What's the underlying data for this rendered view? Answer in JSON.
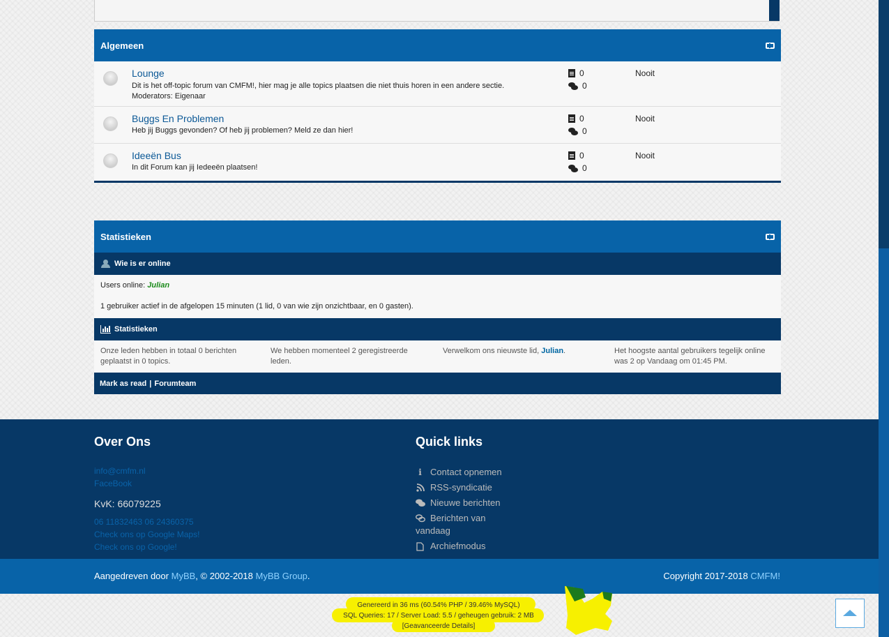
{
  "algemeen": {
    "title": "Algemeen",
    "forums": [
      {
        "title": "Lounge",
        "description": "Dit is het off-topic forum van CMFM!, hier mag je alle topics plaatsen die niet thuis horen in een andere sectie.",
        "moderators": "Moderators: Eigenaar",
        "threads": "0",
        "posts": "0",
        "last_post": "Nooit"
      },
      {
        "title": "Buggs En Problemen",
        "description": "Heb jij Buggs gevonden? Of heb jij problemen? Meld ze dan hier!",
        "threads": "0",
        "posts": "0",
        "last_post": "Nooit"
      },
      {
        "title": "Ideeën Bus",
        "description": "In dit Forum kan jij Iedeeën plaatsen!",
        "threads": "0",
        "posts": "0",
        "last_post": "Nooit"
      }
    ]
  },
  "statistieken": {
    "title": "Statistieken",
    "online_header": "Wie is er online",
    "users_online_label": "Users online:",
    "online_user": "Julian",
    "active_text": "1 gebruiker actief in de afgelopen 15 minuten (1 lid, 0 van wie zijn onzichtbaar, en 0 gasten).",
    "stats_header": "Statistieken",
    "stat_posts": "Onze leden hebben in totaal 0 berichten geplaatst in 0 topics.",
    "stat_members": "We hebben momenteel 2 geregistreerde leden.",
    "stat_newest_prefix": "Verwelkom ons nieuwste lid,",
    "stat_newest_user": "Julian",
    "stat_newest_suffix": ".",
    "stat_record": "Het hoogste aantal gebruikers tegelijk online was 2 op Vandaag om 01:45 PM.",
    "footer_mark_read": "Mark as read",
    "footer_sep": "|",
    "footer_forumteam": "Forumteam"
  },
  "footer": {
    "about_title": "Over Ons",
    "email": "info@cmfm.nl",
    "facebook": "FaceBook",
    "kvk": "KvK: 66079225",
    "phones": "06 11832463 06 24360375",
    "maps": "Check ons op Google Maps!",
    "google": "Check ons op Google!",
    "quick_title": "Quick links",
    "quick_links": [
      {
        "label": "Contact opnemen",
        "icon": "info-icon"
      },
      {
        "label": "RSS-syndicatie",
        "icon": "rss-icon"
      },
      {
        "label": "Nieuwe berichten",
        "icon": "comments-icon"
      },
      {
        "label": "Berichten van vandaag",
        "icon": "comments-outline-icon"
      },
      {
        "label": "Archiefmodus",
        "icon": "file-icon"
      }
    ],
    "powered_prefix": "Aangedreven door",
    "mybb": "MyBB",
    "copyright_mid": ", © 2002-2018",
    "mybb_group": "MyBB Group",
    "period": ".",
    "copyright_right": "Copyright 2017-2018",
    "cmfm": "CMFM!"
  },
  "debug": {
    "line1": "Genereerd in 36 ms (60.54% PHP / 39.46% MySQL)",
    "line2": "SQL Queries: 17 / Server Load: 5.5 / geheugen gebruik: 2 MB",
    "line3": "[Geavanceerde Details]"
  },
  "colors": {
    "primary": "#0863a8",
    "dark": "#073866",
    "highlight": "#f7f000"
  }
}
